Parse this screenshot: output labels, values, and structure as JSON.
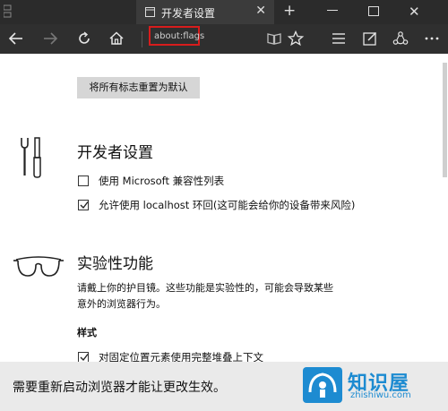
{
  "tab": {
    "title": "开发者设置",
    "close": "✕",
    "new": "+"
  },
  "window": {
    "close": "✕"
  },
  "address": {
    "url": "about:flags"
  },
  "reset_button": "将所有标志重置为默认",
  "developer": {
    "title": "开发者设置",
    "options": [
      {
        "label": "使用 Microsoft 兼容性列表",
        "checked": false
      },
      {
        "label": "允许使用 localhost 环回(这可能会给你的设备带来风险)",
        "checked": true
      }
    ]
  },
  "experimental": {
    "title": "实验性功能",
    "description_line1": "请戴上你的护目镜。这些功能是实验性的，可能会导致某些",
    "description_line2": "意外的浏览器行为。",
    "section_style": "样式",
    "options": [
      {
        "label": "对固定位置元素使用完整堆叠上下文",
        "checked": true
      }
    ]
  },
  "banner": {
    "text": "需要重新启动浏览器才能让更改生效。"
  },
  "watermark": {
    "title": "知识屋",
    "domain": "zhishiwu.com"
  },
  "colors": {
    "chrome_dark": "#2b2b2b",
    "toolbar": "#2f2f2f",
    "highlight_red": "#d71c1c",
    "banner_bg": "#eaeaea",
    "watermark_blue": "#1d8bd1"
  }
}
